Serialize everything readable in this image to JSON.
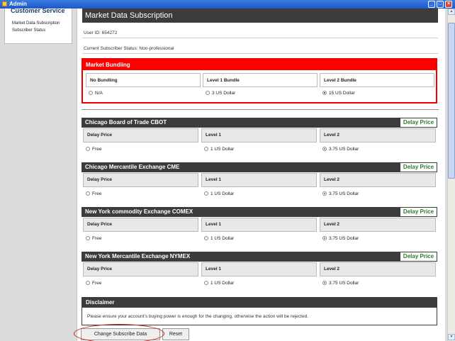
{
  "window": {
    "title": "Admin",
    "icon": "admin-app-icon"
  },
  "sidebar": {
    "heading": "Customer Service",
    "links": [
      "Market Data Subscription",
      "Subscriber Status"
    ]
  },
  "page": {
    "title": "Market Data Subscription",
    "user_id": "User ID: 654272",
    "status": "Current Subscriber Status: Non-professional"
  },
  "bundling": {
    "title": "Market Bundling",
    "columns": [
      "No Bundling",
      "Level 1 Bundle",
      "Level 2 Bundle"
    ],
    "options": [
      "N/A",
      "3 US Dollar",
      "15 US Dollar"
    ],
    "selected_index": 2
  },
  "exchanges": [
    {
      "name": "Chicago Board of Trade CBOT",
      "badge": "Delay Price",
      "columns": [
        "Delay Price",
        "Level 1",
        "Level 2"
      ],
      "options": [
        "Free",
        "1 US Dollar",
        "3.75 US Dollar"
      ],
      "selected_index": 2
    },
    {
      "name": "Chicago Mercantile Exchange CME",
      "badge": "Delay Price",
      "columns": [
        "Delay Price",
        "Level 1",
        "Level 2"
      ],
      "options": [
        "Free",
        "1 US Dollar",
        "3.75 US Dollar"
      ],
      "selected_index": 2
    },
    {
      "name": "New York commodity Exchange COMEX",
      "badge": "Delay Price",
      "columns": [
        "Delay Price",
        "Level 1",
        "Level 2"
      ],
      "options": [
        "Free",
        "1 US Dollar",
        "3.75 US Dollar"
      ],
      "selected_index": 2
    },
    {
      "name": "New York Mercantile Exchange NYMEX",
      "badge": "Delay Price",
      "columns": [
        "Delay Price",
        "Level 1",
        "Level 2"
      ],
      "options": [
        "Free",
        "1 US Dollar",
        "3.75 US Dollar"
      ],
      "selected_index": 2
    }
  ],
  "disclaimer": {
    "title": "Disclaimer",
    "text": "Please ensure your account's buying power is enough for the changing, otherwise the action will be rejected."
  },
  "buttons": {
    "change": "Change Subscribe Data",
    "reset": "Reset"
  },
  "colors": {
    "header_dark": "#3c3c3c",
    "bundle_red": "#ff0000",
    "delay_green": "#2e7a2e",
    "title_blue": "#1f57c9"
  }
}
